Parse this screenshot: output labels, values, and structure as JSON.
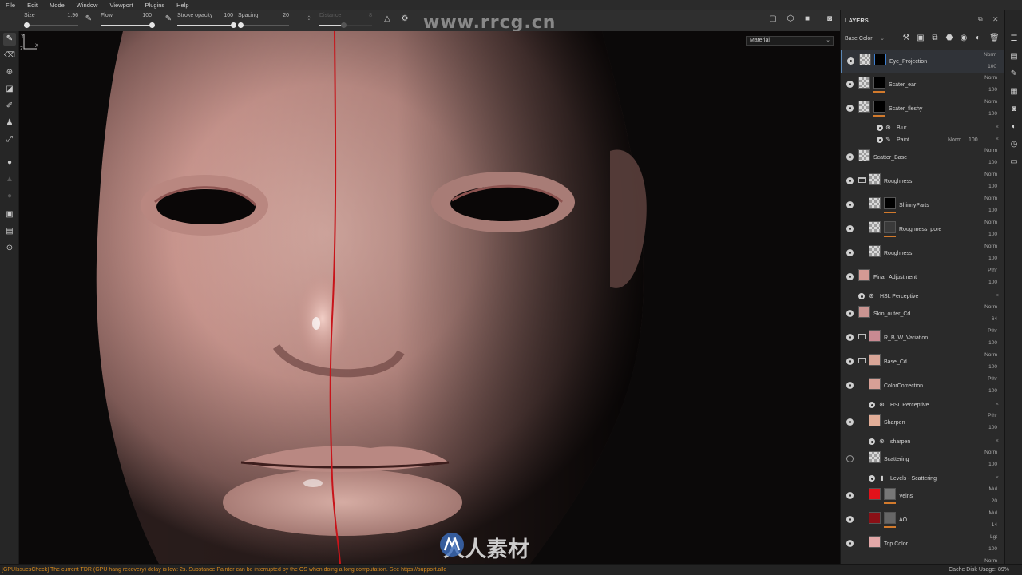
{
  "menu": [
    "File",
    "Edit",
    "Mode",
    "Window",
    "Viewport",
    "Plugins",
    "Help"
  ],
  "properties": {
    "size": {
      "label": "Size",
      "value": "1.96",
      "fraction": 0.05
    },
    "flow": {
      "label": "Flow",
      "value": "100",
      "fraction": 1.0
    },
    "stroke_opacity": {
      "label": "Stroke opacity",
      "value": "100",
      "fraction": 1.0
    },
    "spacing": {
      "label": "Spacing",
      "value": "20",
      "fraction": 0.05
    },
    "distance": {
      "label": "Distance",
      "value": "8",
      "fraction": 0.45
    }
  },
  "viewport": {
    "material_mode": "Material",
    "watermark_url": "www.rrcg.cn",
    "watermark_tile": "人人素材社区",
    "brand_text": "人人素材"
  },
  "layers_panel": {
    "title": "LAYERS",
    "channel": "Base Color",
    "rows": [
      {
        "name": "Eye_Projection",
        "blend": "Norm",
        "opacity": "100"
      },
      {
        "name": "Scater_ear",
        "blend": "Norm",
        "opacity": "100"
      },
      {
        "name": "Scater_fleshy",
        "blend": "Norm",
        "opacity": "100"
      },
      {
        "name": "Blur"
      },
      {
        "name": "Paint",
        "blend": "Norm",
        "opacity": "100"
      },
      {
        "name": "Scatter_Base",
        "blend": "Norm",
        "opacity": "100"
      },
      {
        "name": "Roughness",
        "blend": "Norm",
        "opacity": "100"
      },
      {
        "name": "ShinnyParts",
        "blend": "Norm",
        "opacity": "100"
      },
      {
        "name": "Roughness_pore",
        "blend": "Norm",
        "opacity": "100"
      },
      {
        "name": "Roughness",
        "blend": "Norm",
        "opacity": "100"
      },
      {
        "name": "Final_Adjustment",
        "blend": "Pthr",
        "opacity": "100"
      },
      {
        "name": "HSL Perceptive"
      },
      {
        "name": "Skin_outer_Cd",
        "blend": "Norm",
        "opacity": "64"
      },
      {
        "name": "R_B_W_Variation",
        "blend": "Pthr",
        "opacity": "100"
      },
      {
        "name": "Base_Cd",
        "blend": "Norm",
        "opacity": "100"
      },
      {
        "name": "ColorCorrection",
        "blend": "Pthr",
        "opacity": "100"
      },
      {
        "name": "HSL Perceptive"
      },
      {
        "name": "Sharpen",
        "blend": "Pthr",
        "opacity": "100"
      },
      {
        "name": "sharpen"
      },
      {
        "name": "Scattering",
        "blend": "Norm",
        "opacity": "100"
      },
      {
        "name": "Levels - Scattering"
      },
      {
        "name": "Veins",
        "blend": "Mul",
        "opacity": "20"
      },
      {
        "name": "AO",
        "blend": "Mul",
        "opacity": "14"
      },
      {
        "name": "Top Color",
        "blend": "Lgt",
        "opacity": "100"
      },
      {
        "name": "",
        "blend": "Norm",
        "opacity": ""
      }
    ]
  },
  "status": {
    "message": "[GPUIssuesCheck] The current TDR (GPU hang recovery) delay is low: 2s. Substance Painter can be interrupted by the OS when doing a long computation. See https://support.alle",
    "cache": "Cache Disk Usage:  89%"
  },
  "colors": {
    "selection": "#5b87b5",
    "mask_underline": "#d27a2c",
    "status_warning": "#d88a1e",
    "painted_line": "#c8141a"
  }
}
